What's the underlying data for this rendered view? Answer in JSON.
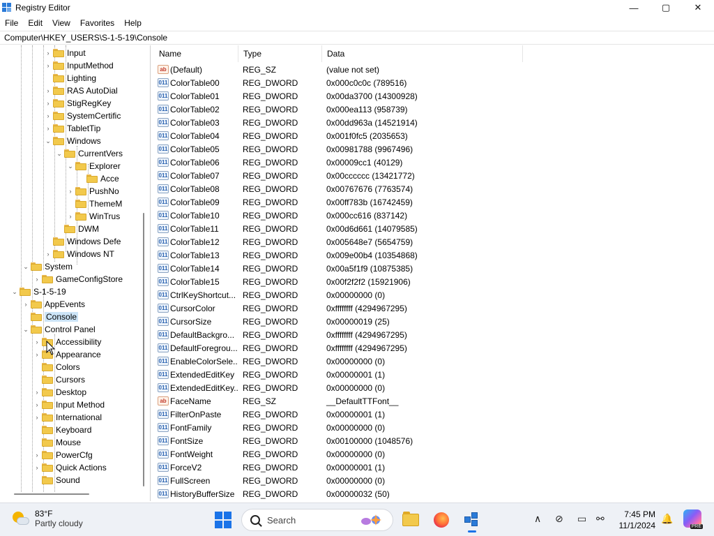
{
  "window": {
    "title": "Registry Editor",
    "controls": {
      "minimize": "—",
      "maximize": "▢",
      "close": "✕"
    }
  },
  "menu": [
    "File",
    "Edit",
    "View",
    "Favorites",
    "Help"
  ],
  "address": "Computer\\HKEY_USERS\\S-1-5-19\\Console",
  "tree": [
    {
      "label": "Input",
      "level": 5,
      "chevron": "›"
    },
    {
      "label": "InputMethod",
      "level": 5,
      "chevron": "›"
    },
    {
      "label": "Lighting",
      "level": 5,
      "chevron": ""
    },
    {
      "label": "RAS AutoDial",
      "level": 5,
      "chevron": "›"
    },
    {
      "label": "StigRegKey",
      "level": 5,
      "chevron": "›"
    },
    {
      "label": "SystemCertific",
      "level": 5,
      "chevron": "›"
    },
    {
      "label": "TabletTip",
      "level": 5,
      "chevron": "›"
    },
    {
      "label": "Windows",
      "level": 5,
      "chevron": "⌄"
    },
    {
      "label": "CurrentVers",
      "level": 6,
      "chevron": "⌄"
    },
    {
      "label": "Explorer",
      "level": 7,
      "chevron": "⌄"
    },
    {
      "label": "Acce",
      "level": 8,
      "chevron": ""
    },
    {
      "label": "PushNo",
      "level": 7,
      "chevron": "›"
    },
    {
      "label": "ThemeM",
      "level": 7,
      "chevron": ""
    },
    {
      "label": "WinTrus",
      "level": 7,
      "chevron": "›"
    },
    {
      "label": "DWM",
      "level": 6,
      "chevron": ""
    },
    {
      "label": "Windows Defe",
      "level": 5,
      "chevron": ""
    },
    {
      "label": "Windows NT",
      "level": 5,
      "chevron": "›"
    },
    {
      "label": "System",
      "level": 3,
      "chevron": "⌄"
    },
    {
      "label": "GameConfigStore",
      "level": 4,
      "chevron": "›"
    },
    {
      "label": "S-1-5-19",
      "level": 2,
      "chevron": "⌄"
    },
    {
      "label": "AppEvents",
      "level": 3,
      "chevron": "›"
    },
    {
      "label": "Console",
      "level": 3,
      "chevron": "",
      "selected": true
    },
    {
      "label": "Control Panel",
      "level": 3,
      "chevron": "⌄"
    },
    {
      "label": "Accessibility",
      "level": 4,
      "chevron": "›"
    },
    {
      "label": "Appearance",
      "level": 4,
      "chevron": "›"
    },
    {
      "label": "Colors",
      "level": 4,
      "chevron": ""
    },
    {
      "label": "Cursors",
      "level": 4,
      "chevron": ""
    },
    {
      "label": "Desktop",
      "level": 4,
      "chevron": "›"
    },
    {
      "label": "Input Method",
      "level": 4,
      "chevron": "›"
    },
    {
      "label": "International",
      "level": 4,
      "chevron": "›"
    },
    {
      "label": "Keyboard",
      "level": 4,
      "chevron": ""
    },
    {
      "label": "Mouse",
      "level": 4,
      "chevron": ""
    },
    {
      "label": "PowerCfg",
      "level": 4,
      "chevron": "›"
    },
    {
      "label": "Quick Actions",
      "level": 4,
      "chevron": "›"
    },
    {
      "label": "Sound",
      "level": 4,
      "chevron": ""
    }
  ],
  "columns": {
    "name": "Name",
    "type": "Type",
    "data": "Data"
  },
  "values": [
    {
      "kind": "sz",
      "icon": "ab",
      "name": "(Default)",
      "type": "REG_SZ",
      "data": "(value not set)"
    },
    {
      "kind": "dw",
      "icon": "011",
      "name": "ColorTable00",
      "type": "REG_DWORD",
      "data": "0x000c0c0c (789516)"
    },
    {
      "kind": "dw",
      "icon": "011",
      "name": "ColorTable01",
      "type": "REG_DWORD",
      "data": "0x00da3700 (14300928)"
    },
    {
      "kind": "dw",
      "icon": "011",
      "name": "ColorTable02",
      "type": "REG_DWORD",
      "data": "0x000ea113 (958739)"
    },
    {
      "kind": "dw",
      "icon": "011",
      "name": "ColorTable03",
      "type": "REG_DWORD",
      "data": "0x00dd963a (14521914)"
    },
    {
      "kind": "dw",
      "icon": "011",
      "name": "ColorTable04",
      "type": "REG_DWORD",
      "data": "0x001f0fc5 (2035653)"
    },
    {
      "kind": "dw",
      "icon": "011",
      "name": "ColorTable05",
      "type": "REG_DWORD",
      "data": "0x00981788 (9967496)"
    },
    {
      "kind": "dw",
      "icon": "011",
      "name": "ColorTable06",
      "type": "REG_DWORD",
      "data": "0x00009cc1 (40129)"
    },
    {
      "kind": "dw",
      "icon": "011",
      "name": "ColorTable07",
      "type": "REG_DWORD",
      "data": "0x00cccccc (13421772)"
    },
    {
      "kind": "dw",
      "icon": "011",
      "name": "ColorTable08",
      "type": "REG_DWORD",
      "data": "0x00767676 (7763574)"
    },
    {
      "kind": "dw",
      "icon": "011",
      "name": "ColorTable09",
      "type": "REG_DWORD",
      "data": "0x00ff783b (16742459)"
    },
    {
      "kind": "dw",
      "icon": "011",
      "name": "ColorTable10",
      "type": "REG_DWORD",
      "data": "0x000cc616 (837142)"
    },
    {
      "kind": "dw",
      "icon": "011",
      "name": "ColorTable11",
      "type": "REG_DWORD",
      "data": "0x00d6d661 (14079585)"
    },
    {
      "kind": "dw",
      "icon": "011",
      "name": "ColorTable12",
      "type": "REG_DWORD",
      "data": "0x005648e7 (5654759)"
    },
    {
      "kind": "dw",
      "icon": "011",
      "name": "ColorTable13",
      "type": "REG_DWORD",
      "data": "0x009e00b4 (10354868)"
    },
    {
      "kind": "dw",
      "icon": "011",
      "name": "ColorTable14",
      "type": "REG_DWORD",
      "data": "0x00a5f1f9 (10875385)"
    },
    {
      "kind": "dw",
      "icon": "011",
      "name": "ColorTable15",
      "type": "REG_DWORD",
      "data": "0x00f2f2f2 (15921906)"
    },
    {
      "kind": "dw",
      "icon": "011",
      "name": "CtrlKeyShortcut...",
      "type": "REG_DWORD",
      "data": "0x00000000 (0)"
    },
    {
      "kind": "dw",
      "icon": "011",
      "name": "CursorColor",
      "type": "REG_DWORD",
      "data": "0xffffffff (4294967295)"
    },
    {
      "kind": "dw",
      "icon": "011",
      "name": "CursorSize",
      "type": "REG_DWORD",
      "data": "0x00000019 (25)"
    },
    {
      "kind": "dw",
      "icon": "011",
      "name": "DefaultBackgro...",
      "type": "REG_DWORD",
      "data": "0xffffffff (4294967295)"
    },
    {
      "kind": "dw",
      "icon": "011",
      "name": "DefaultForegrou...",
      "type": "REG_DWORD",
      "data": "0xffffffff (4294967295)"
    },
    {
      "kind": "dw",
      "icon": "011",
      "name": "EnableColorSele...",
      "type": "REG_DWORD",
      "data": "0x00000000 (0)"
    },
    {
      "kind": "dw",
      "icon": "011",
      "name": "ExtendedEditKey",
      "type": "REG_DWORD",
      "data": "0x00000001 (1)"
    },
    {
      "kind": "dw",
      "icon": "011",
      "name": "ExtendedEditKey...",
      "type": "REG_DWORD",
      "data": "0x00000000 (0)"
    },
    {
      "kind": "sz",
      "icon": "ab",
      "name": "FaceName",
      "type": "REG_SZ",
      "data": "__DefaultTTFont__"
    },
    {
      "kind": "dw",
      "icon": "011",
      "name": "FilterOnPaste",
      "type": "REG_DWORD",
      "data": "0x00000001 (1)"
    },
    {
      "kind": "dw",
      "icon": "011",
      "name": "FontFamily",
      "type": "REG_DWORD",
      "data": "0x00000000 (0)"
    },
    {
      "kind": "dw",
      "icon": "011",
      "name": "FontSize",
      "type": "REG_DWORD",
      "data": "0x00100000 (1048576)"
    },
    {
      "kind": "dw",
      "icon": "011",
      "name": "FontWeight",
      "type": "REG_DWORD",
      "data": "0x00000000 (0)"
    },
    {
      "kind": "dw",
      "icon": "011",
      "name": "ForceV2",
      "type": "REG_DWORD",
      "data": "0x00000001 (1)"
    },
    {
      "kind": "dw",
      "icon": "011",
      "name": "FullScreen",
      "type": "REG_DWORD",
      "data": "0x00000000 (0)"
    },
    {
      "kind": "dw",
      "icon": "011",
      "name": "HistoryBufferSize",
      "type": "REG_DWORD",
      "data": "0x00000032 (50)"
    }
  ],
  "taskbar": {
    "weather_temp": "83°F",
    "weather_desc": "Partly cloudy",
    "search_placeholder": "Search",
    "time": "7:45 PM",
    "date": "11/1/2024",
    "copilot_badge": "PRE",
    "tray_icons": [
      "chevron-up-icon",
      "network-off-icon",
      "display-icon",
      "accessibility-icon"
    ],
    "bell_glyph": "🔔",
    "tray_glyphs": {
      "chevron": "∧",
      "network": "⊘",
      "display": "▭",
      "access": "⚯"
    }
  },
  "colors": {
    "selection": "#cce4f7",
    "accent": "#1a73e8",
    "folder": "#f2c94c"
  }
}
